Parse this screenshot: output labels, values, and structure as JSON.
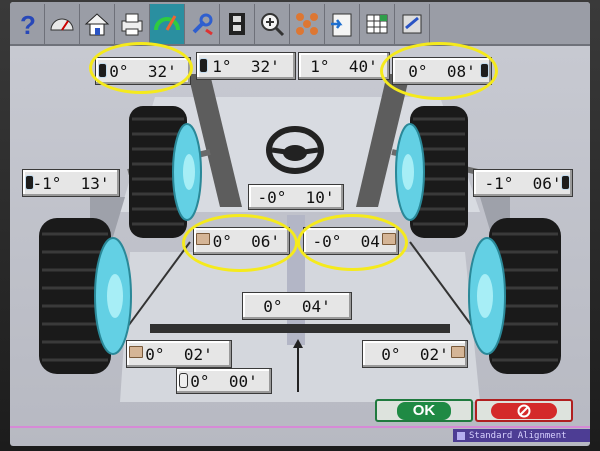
{
  "toolbar": {
    "icons": [
      "help-icon",
      "gauge-icon",
      "home-icon",
      "printer-icon",
      "adjust-meter-icon",
      "wrench-icon",
      "film-icon",
      "zoom-icon",
      "grid-icon",
      "clipboard-icon",
      "spreadsheet-icon",
      "vehicle-icon"
    ]
  },
  "readings": {
    "front_left_camber": "0°  32'",
    "front_left_caster": "1°  32'",
    "front_right_caster": "1°  40'",
    "front_right_camber": "0°  08'",
    "front_left_toe_outer": "-1°  13'",
    "front_right_toe_outer": "-1°  06'",
    "steering_total": "-0°  10'",
    "front_left_toe": "-0°  06'",
    "front_right_toe": "-0°  04'",
    "rear_total_toe": "0°  04'",
    "rear_left": "0°  02'",
    "rear_right": "0°  02'",
    "thrust_angle": "0°  00'"
  },
  "buttons": {
    "ok_label": "OK"
  },
  "status_text": "Standard Alignment",
  "colors": {
    "highlight": "#f5ea1c",
    "ok_green": "#1f8a44",
    "cancel_red": "#d42a2a",
    "status_bg": "#4d3d94"
  }
}
